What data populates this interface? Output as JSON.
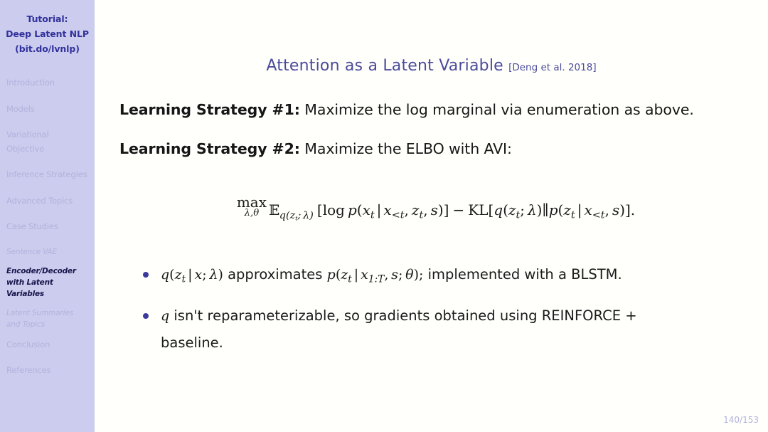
{
  "sidebar": {
    "title_lines": [
      "Tutorial:",
      "Deep Latent NLP",
      "(bit.do/lvnlp)"
    ],
    "items": [
      {
        "label": "Introduction",
        "level": "section",
        "current": false
      },
      {
        "label": "Models",
        "level": "section",
        "current": false
      },
      {
        "label": "Variational Objective",
        "level": "section",
        "current": false
      },
      {
        "label": "Inference Strategies",
        "level": "section",
        "current": false
      },
      {
        "label": "Advanced Topics",
        "level": "section",
        "current": false
      },
      {
        "label": "Case Studies",
        "level": "section",
        "current": false
      },
      {
        "label": "Sentence VAE",
        "level": "subsection",
        "current": false
      },
      {
        "label": "Encoder/Decoder with Latent Variables",
        "level": "subsection",
        "current": true
      },
      {
        "label": "Latent Summaries and Topics",
        "level": "subsection",
        "current": false
      },
      {
        "label": "Conclusion",
        "level": "section",
        "current": false
      },
      {
        "label": "References",
        "level": "section",
        "current": false
      }
    ],
    "background_color": "#ccccee",
    "title_color": "#31319c",
    "item_color": "#b2b2dd",
    "current_item_color": "#15154b"
  },
  "slide": {
    "title": "Attention as a Latent Variable",
    "title_citation": "[Deng et al. 2018]",
    "title_color": "#4b4b9c",
    "background_color": "#fffffb",
    "page_number": "140/153"
  },
  "strategies": [
    {
      "label": "Learning Strategy #1:",
      "text": "Maximize the log marginal via enumeration as above."
    },
    {
      "label": "Learning Strategy #2:",
      "text": "Maximize the ELBO with AVI:"
    }
  ],
  "equation": {
    "plain": "max_{λ,θ} E_{q(z_t; λ)} [log p(x_t | x_<t, z_t, s)] − KL[q(z_t; λ)‖p(z_t | x_<t, s)].",
    "operator": "max",
    "operator_limits": "λ,θ",
    "expectation_symbol": "E",
    "expectation_subscript": "q(z_t; λ)",
    "first_term": "[log p(x_t | x_<t, z_t, s)]",
    "minus": "−",
    "kl_term": "KL[q(z_t; λ)‖p(z_t | x_<t, s)].",
    "parts": {
      "log": "log",
      "p": "p",
      "x": "x",
      "t": "t",
      "lt": "<t",
      "z": "z",
      "s": "s",
      "q": "q",
      "lambda": "λ",
      "theta": "θ",
      "KL": "KL",
      "bar": "|",
      "dbar": "‖",
      "lbrack": "[",
      "rbrack": "]",
      "lparen": "(",
      "rparen": ")",
      "comma": ",",
      "semicolon": ";",
      "period": "."
    }
  },
  "bullets": [
    {
      "plain": "q(z_t | x; λ) approximates p(z_t | x_{1:T}, s; θ); implemented with a BLSTM.",
      "math_1": "q(z_t | x; λ)",
      "text_1": "approximates",
      "math_2": "p(z_t | x_{1:T}, s; θ);",
      "text_2": "implemented with a BLSTM."
    },
    {
      "plain": "q isn't reparameterizable, so gradients obtained using REINFORCE + baseline.",
      "math_1": "q",
      "text_1": "isn't reparameterizable, so gradients obtained using REINFORCE +",
      "text_2": "baseline."
    }
  ],
  "bullet_marker_color": "#3b3b9e"
}
